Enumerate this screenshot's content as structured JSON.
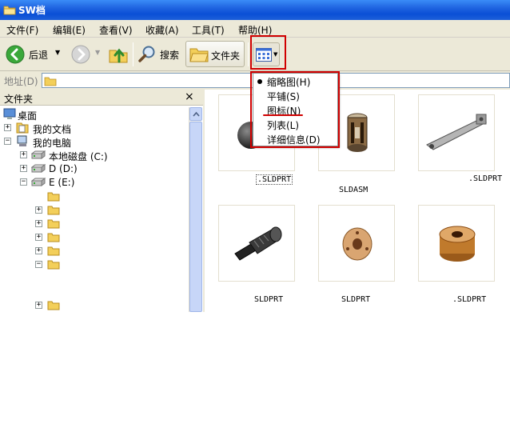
{
  "window": {
    "title": "SW档",
    "icon": "folder-icon"
  },
  "menu": {
    "items": [
      {
        "label": "文件(F)"
      },
      {
        "label": "编辑(E)"
      },
      {
        "label": "查看(V)"
      },
      {
        "label": "收藏(A)"
      },
      {
        "label": "工具(T)"
      },
      {
        "label": "帮助(H)"
      }
    ]
  },
  "toolbar": {
    "back_label": "后退",
    "search_label": "搜索",
    "folders_label": "文件夹",
    "views_icon": "views-icon"
  },
  "address": {
    "label": "地址(D)",
    "value": ""
  },
  "folders_pane": {
    "title": "文件夹",
    "close_label": "×",
    "tree": [
      {
        "label": "桌面",
        "icon": "desktop-icon"
      },
      {
        "label": "我的文档",
        "icon": "my-documents-icon",
        "expander": "+"
      },
      {
        "label": "我的电脑",
        "icon": "my-computer-icon",
        "expander": "−"
      },
      {
        "label": "本地磁盘 (C:)",
        "icon": "drive-icon",
        "expander": "+"
      },
      {
        "label": "D (D:)",
        "icon": "drive-icon",
        "expander": "+"
      },
      {
        "label": "E (E:)",
        "icon": "drive-icon",
        "expander": "−"
      }
    ],
    "subfolders": [
      {
        "expander": ""
      },
      {
        "expander": "+"
      },
      {
        "expander": "+"
      },
      {
        "expander": "+"
      },
      {
        "expander": "+"
      },
      {
        "expander": "−"
      },
      {
        "expander": "+"
      }
    ]
  },
  "files": [
    {
      "name": ".SLDPRT",
      "color": "#444444"
    },
    {
      "name": "SLDASM",
      "color": "#6b4a2a"
    },
    {
      "name": ".SLDPRT",
      "color": "#8a8a8a"
    },
    {
      "name": "SLDPRT",
      "color": "#3a3a3a"
    },
    {
      "name": "SLDPRT",
      "color": "#c98d57"
    },
    {
      "name": ".SLDPRT",
      "color": "#c07a2c"
    }
  ],
  "views_menu": {
    "selected": "缩略图(H)",
    "items": [
      {
        "label": "缩略图(H)"
      },
      {
        "label": "平铺(S)"
      },
      {
        "label": "图标(N)"
      },
      {
        "label": "列表(L)"
      },
      {
        "label": "详细信息(D)"
      }
    ]
  },
  "colors": {
    "title_bar": "#0a4fd6",
    "highlight": "#d00000",
    "window_bg": "#ece9d8"
  }
}
